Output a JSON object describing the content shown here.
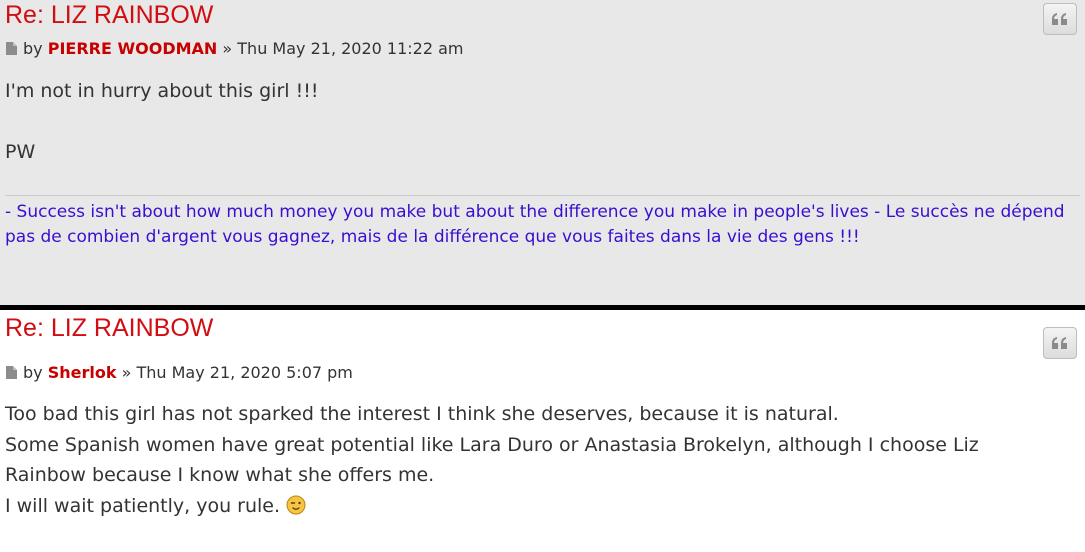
{
  "posts": [
    {
      "title": "Re: LIZ RAINBOW",
      "by_label": "by",
      "author": "PIERRE WOODMAN",
      "separator": "»",
      "date": "Thu May 21, 2020 11:22 am",
      "quote_icon": "quote-icon",
      "content": [
        "I'm not in hurry about this girl !!!",
        "",
        "PW"
      ],
      "signature": "- Success isn't about how much money you make but about the difference you make in people's lives - Le succès ne dépend pas de combien d'argent vous gagnez, mais de la différence que vous faites dans la vie des gens !!!"
    },
    {
      "title": "Re: LIZ RAINBOW",
      "by_label": "by",
      "author": "Sherlok",
      "separator": "»",
      "date": "Thu May 21, 2020 5:07 pm",
      "quote_icon": "quote-icon",
      "content": [
        "Too bad this girl has not sparked the interest I think she deserves, because it is natural.",
        "Some Spanish women have great potential like Lara Duro or Anastasia Brokelyn, although I choose Liz",
        "Rainbow because I know what she offers me.",
        "I will wait patiently, you rule."
      ],
      "smiley": "wink-smiley-icon"
    }
  ],
  "colors": {
    "title": "#d10d12",
    "author": "#c80000",
    "signature": "#3a0ed1",
    "post1_bg": "#e8e8e8",
    "post2_bg": "#ffffff"
  }
}
